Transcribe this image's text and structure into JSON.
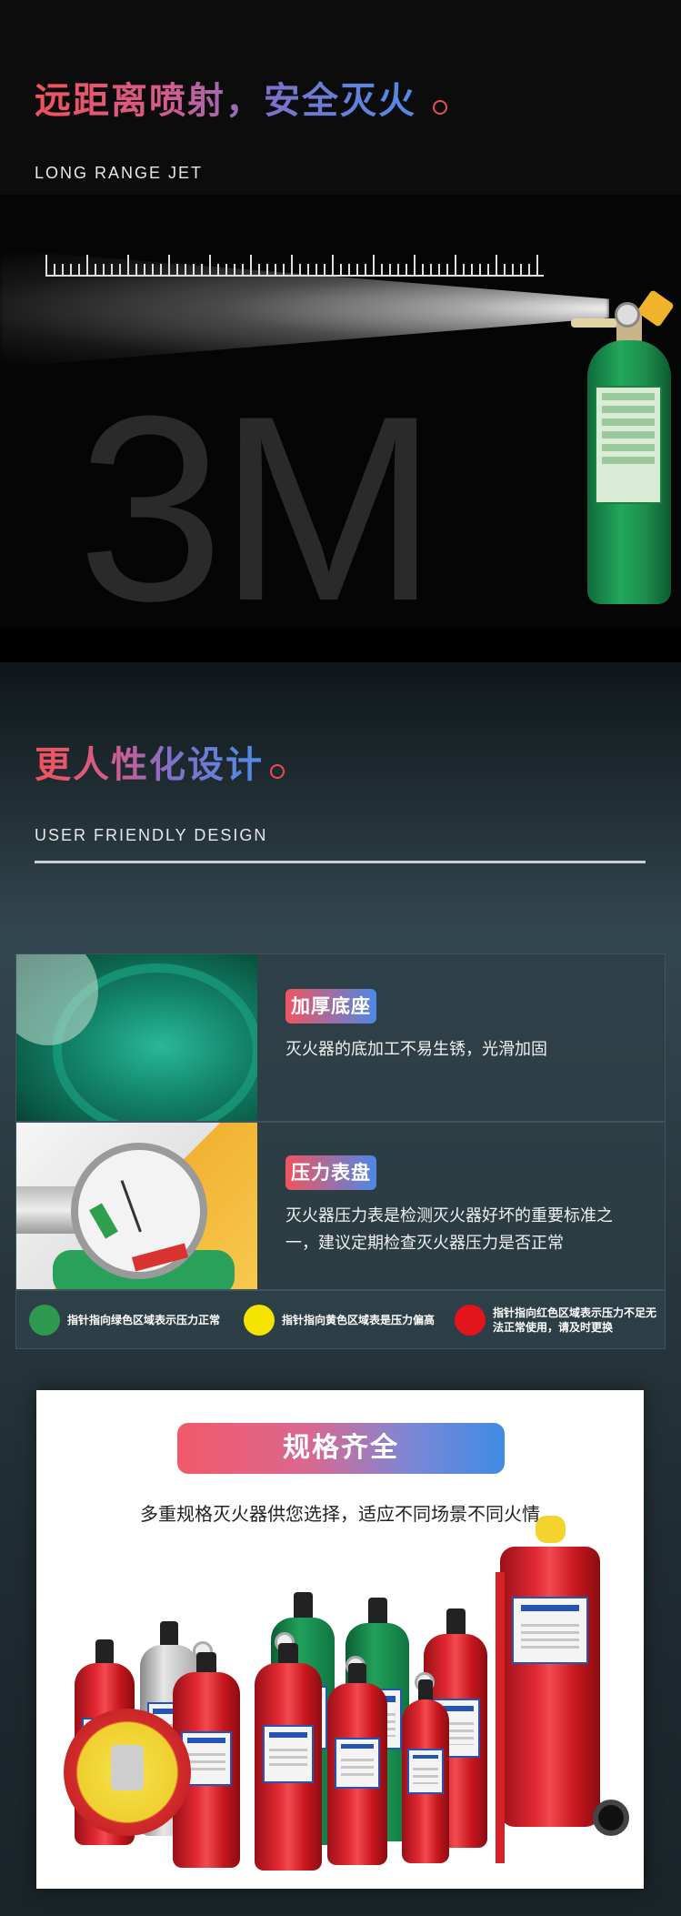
{
  "section_jet": {
    "title": "远距离喷射，安全灭火",
    "subtitle": "LONG RANGE JET",
    "distance": "3M",
    "colors": {
      "title_start": "#f0535c",
      "title_end": "#4c8ee8",
      "extinguisher": "#23a85c"
    }
  },
  "section_design": {
    "title": "更人性化设计",
    "subtitle": "USER FRIENDLY DESIGN",
    "features": [
      {
        "tag": "加厚底座",
        "text": "灭火器的底加工不易生锈，光滑加固",
        "image_icon": "extinguisher-base-photo"
      },
      {
        "tag": "压力表盘",
        "text": "灭火器压力表是检测灭火器好坏的重要标准之一，建议定期检查灭火器压力是否正常",
        "image_icon": "pressure-gauge-photo"
      }
    ],
    "legend": [
      {
        "color": "#2e9a4f",
        "text": "指针指向绿色区域表示压力正常"
      },
      {
        "color": "#f5e400",
        "text": "指针指向黄色区域表是压力偏高"
      },
      {
        "color": "#e3141c",
        "text": "指针指向红色区域表示压力不足无法正常使用，请及时更换"
      }
    ]
  },
  "section_spec": {
    "banner": "规格齐全",
    "description": "多重规格灭火器供您选择，适应不同场景不同火情",
    "image_icon": "extinguisher-lineup-photo"
  }
}
